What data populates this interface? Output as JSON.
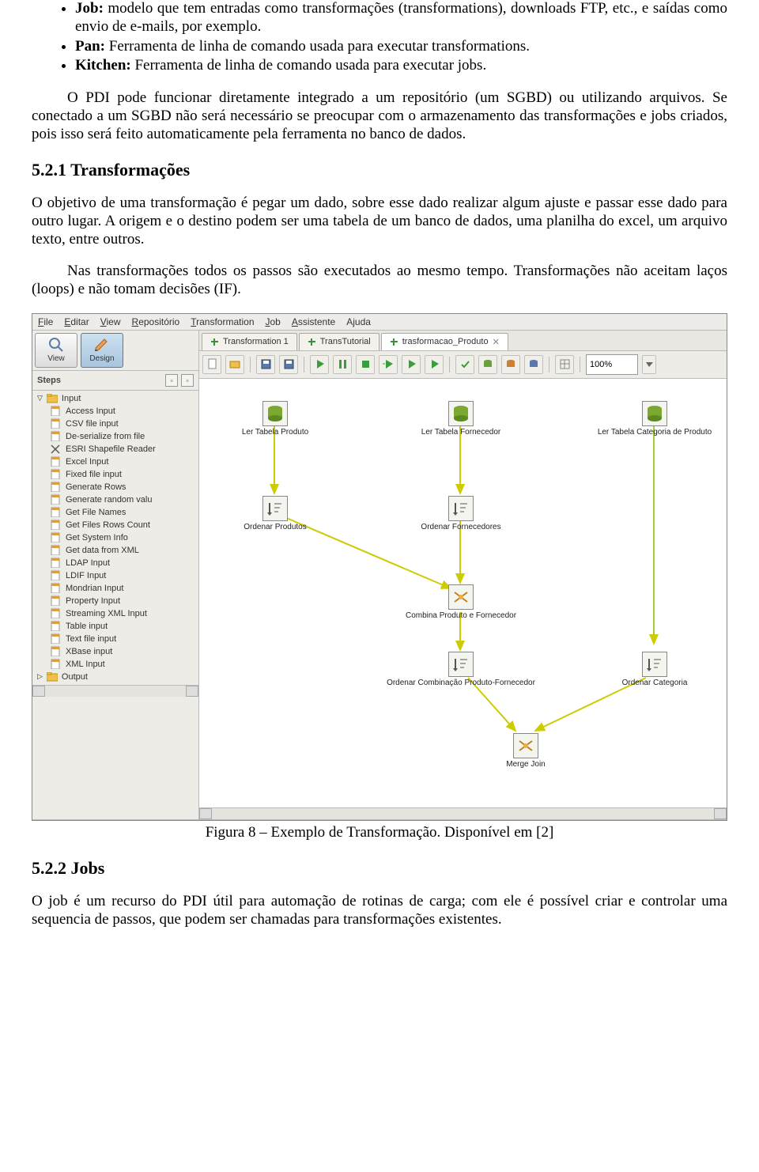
{
  "bullets": [
    {
      "b": "Job:",
      "t": " modelo que tem entradas como transformações (transformations), downloads FTP, etc., e saídas como envio de e-mails, por exemplo."
    },
    {
      "b": "Pan:",
      "t": " Ferramenta de linha de comando usada para executar transformations."
    },
    {
      "b": "Kitchen:",
      "t": " Ferramenta de linha de comando usada para executar jobs."
    }
  ],
  "para1": "O PDI pode funcionar diretamente integrado a um repositório (um SGBD) ou utilizando arquivos. Se conectado a um SGBD não será necessário se preocupar com o armazenamento das transformações e jobs criados, pois isso será feito automaticamente pela ferramenta no banco de dados.",
  "h1": "5.2.1 Transformações",
  "para2": "O objetivo de uma transformação é pegar um dado, sobre esse dado realizar algum ajuste e passar esse dado para outro lugar. A origem e o destino podem ser uma tabela de um banco de dados, uma planilha do excel, um arquivo texto, entre outros.",
  "para3": "Nas transformações todos os passos são executados ao mesmo tempo. Transformações não aceitam laços (loops) e não tomam decisões (IF).",
  "menu": [
    "File",
    "Editar",
    "View",
    "Repositório",
    "Transformation",
    "Job",
    "Assistente",
    "Ajuda"
  ],
  "viewBtn": "View",
  "designBtn": "Design",
  "stepsLabel": "Steps",
  "inputFolder": "Input",
  "outputFolder": "Output",
  "steps": [
    "Access Input",
    "CSV file input",
    "De-serialize from file",
    "ESRI Shapefile Reader",
    "Excel Input",
    "Fixed file input",
    "Generate Rows",
    "Generate random valu",
    "Get File Names",
    "Get Files Rows Count",
    "Get System Info",
    "Get data from XML",
    "LDAP Input",
    "LDIF Input",
    "Mondrian Input",
    "Property Input",
    "Streaming XML Input",
    "Table input",
    "Text file input",
    "XBase input",
    "XML Input"
  ],
  "tabs": [
    "Transformation 1",
    "TransTutorial",
    "trasformacao_Produto"
  ],
  "zoom": "100%",
  "nodes": {
    "n1": "Ler Tabela Produto",
    "n2": "Ler Tabela Fornecedor",
    "n3": "Ler Tabela Categoria de Produto",
    "n4": "Ordenar Produtos",
    "n5": "Ordenar Fornecedores",
    "n6": "Combina Produto e Fornecedor",
    "n7": "Ordenar Combinação Produto-Fornecedor",
    "n8": "Ordenar Categoria",
    "n9": "Merge Join"
  },
  "caption": "Figura 8 – Exemplo de Transformação. Disponível em [2]",
  "h2": "5.2.2 Jobs",
  "para4": "O job é um recurso do PDI útil para automação de rotinas de carga; com ele é possível criar e controlar uma sequencia de passos, que podem ser chamadas para transformações existentes."
}
